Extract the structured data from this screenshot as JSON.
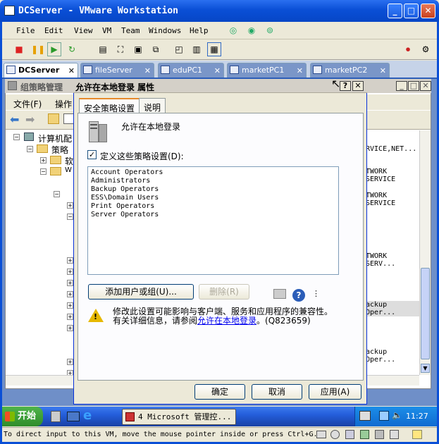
{
  "window": {
    "title": "DCServer - VMware Workstation"
  },
  "menu": [
    "File",
    "Edit",
    "View",
    "VM",
    "Team",
    "Windows",
    "Help"
  ],
  "vm_tabs": [
    {
      "label": "DCServer",
      "active": true
    },
    {
      "label": "fileServer",
      "active": false
    },
    {
      "label": "eduPC1",
      "active": false
    },
    {
      "label": "marketPC1",
      "active": false
    },
    {
      "label": "marketPC2",
      "active": false
    }
  ],
  "mmc": {
    "title": "组策略管理",
    "menu": [
      "文件(F)",
      "操作"
    ],
    "tree": [
      "计算机配",
      "策略",
      "软",
      "W"
    ],
    "right_values": [
      "RVICE,NET...",
      "TWORK SERVICE",
      "TWORK SERVICE",
      "TWORK SERV...",
      "ackup Oper...",
      "ackup Oper..."
    ]
  },
  "dialog": {
    "title": "允许在本地登录 属性",
    "tabs": [
      "安全策略设置",
      "说明"
    ],
    "policy_name": "允许在本地登录",
    "define_label": "定义这些策略设置(D):",
    "define_checked": true,
    "entries": [
      "Account Operators",
      "Administrators",
      "Backup Operators",
      "ESS\\Domain Users",
      "Print Operators",
      "Server Operators"
    ],
    "add_button": "添加用户或组(U)...",
    "remove_button": "删除(R)",
    "warning_line1": "修改此设置可能影响与客户端、服务和应用程序的兼容性。",
    "warning_line2_pre": "有关详细信息，请参阅",
    "warning_link": "允许在本地登录",
    "warning_line2_post": "。(Q823659)",
    "ok": "确定",
    "cancel": "取消",
    "apply": "应用(A)"
  },
  "taskbar": {
    "start": "开始",
    "task": "4 Microsoft 管理控...",
    "clock": "11:27"
  },
  "status": "To direct input to this VM, move the mouse pointer inside or press Ctrl+G."
}
